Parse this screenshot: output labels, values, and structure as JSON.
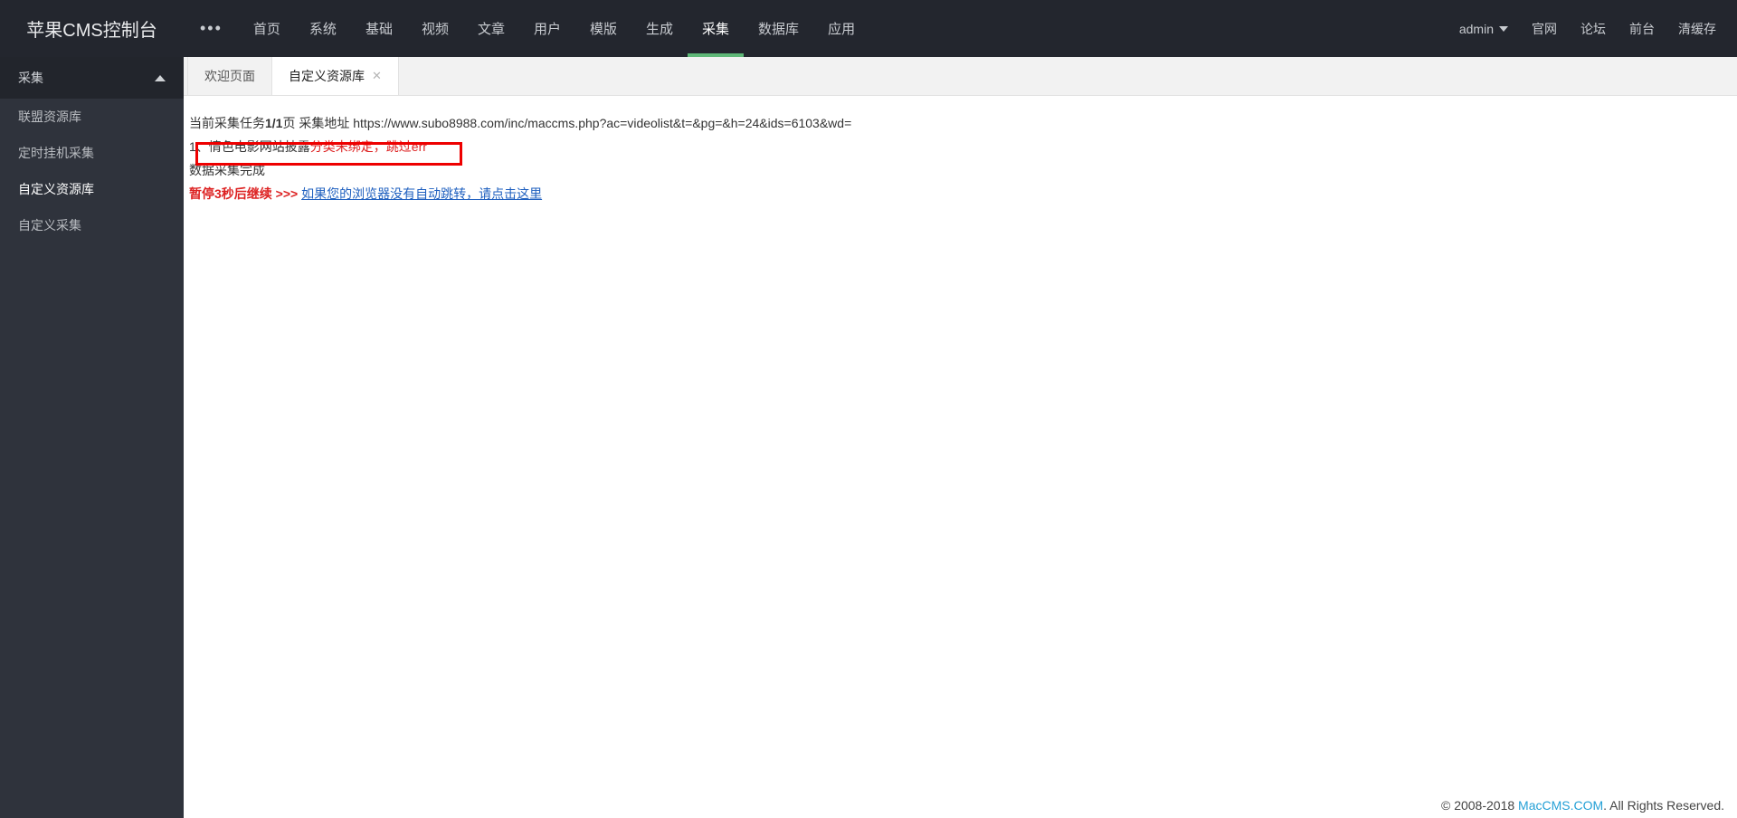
{
  "brand": "苹果CMS控制台",
  "top_nav": {
    "more": "•••",
    "items": [
      "首页",
      "系统",
      "基础",
      "视频",
      "文章",
      "用户",
      "模版",
      "生成",
      "采集",
      "数据库",
      "应用"
    ],
    "active_index": 8
  },
  "top_right": {
    "admin": "admin",
    "links": [
      "官网",
      "论坛",
      "前台",
      "清缓存"
    ]
  },
  "sidebar": {
    "head": "采集",
    "items": [
      "联盟资源库",
      "定时挂机采集",
      "自定义资源库",
      "自定义采集"
    ],
    "active_index": 2
  },
  "tabs": {
    "items": [
      {
        "label": "欢迎页面",
        "closable": false
      },
      {
        "label": "自定义资源库",
        "closable": true
      }
    ],
    "active_index": 1
  },
  "task": {
    "prefix": "当前采集任务",
    "page": "1/1",
    "suffix": "页 采集地址 ",
    "url": "https://www.subo8988.com/inc/maccms.php?ac=videolist&t=&pg=&h=24&ids=6103&wd="
  },
  "line1": {
    "a": "1、情色电影网站披露",
    "b": "分类未绑定，跳过err"
  },
  "done": "数据采集完成",
  "pause": {
    "a": "暂停",
    "b": "3",
    "c": "秒后继续 >>> ",
    "link": "如果您的浏览器没有自动跳转，请点击这里"
  },
  "footer": {
    "a": "© 2008-2018 ",
    "b": "MacCMS.COM",
    "c": ". All Rights Reserved."
  }
}
